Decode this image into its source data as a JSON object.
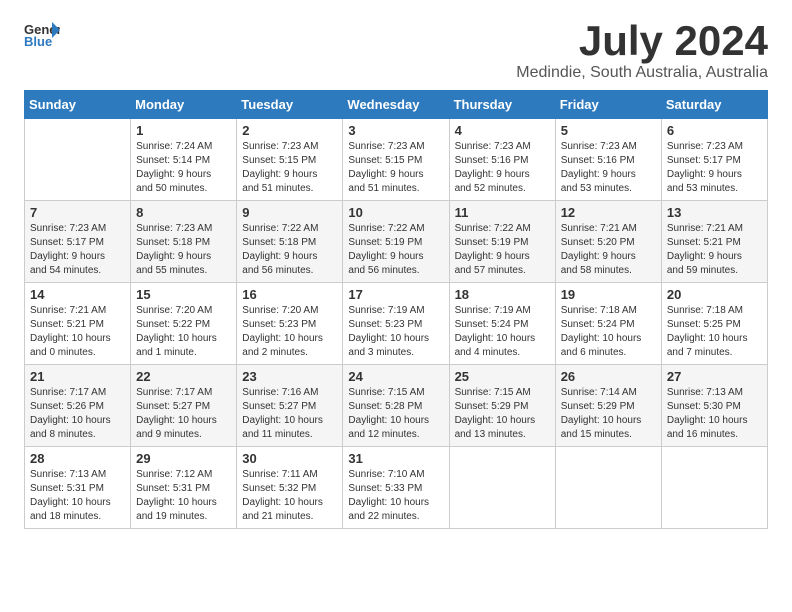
{
  "header": {
    "logo_line1": "General",
    "logo_line2": "Blue",
    "title": "July 2024",
    "subtitle": "Medindie, South Australia, Australia"
  },
  "weekdays": [
    "Sunday",
    "Monday",
    "Tuesday",
    "Wednesday",
    "Thursday",
    "Friday",
    "Saturday"
  ],
  "weeks": [
    [
      {
        "day": "",
        "info": ""
      },
      {
        "day": "1",
        "info": "Sunrise: 7:24 AM\nSunset: 5:14 PM\nDaylight: 9 hours\nand 50 minutes."
      },
      {
        "day": "2",
        "info": "Sunrise: 7:23 AM\nSunset: 5:15 PM\nDaylight: 9 hours\nand 51 minutes."
      },
      {
        "day": "3",
        "info": "Sunrise: 7:23 AM\nSunset: 5:15 PM\nDaylight: 9 hours\nand 51 minutes."
      },
      {
        "day": "4",
        "info": "Sunrise: 7:23 AM\nSunset: 5:16 PM\nDaylight: 9 hours\nand 52 minutes."
      },
      {
        "day": "5",
        "info": "Sunrise: 7:23 AM\nSunset: 5:16 PM\nDaylight: 9 hours\nand 53 minutes."
      },
      {
        "day": "6",
        "info": "Sunrise: 7:23 AM\nSunset: 5:17 PM\nDaylight: 9 hours\nand 53 minutes."
      }
    ],
    [
      {
        "day": "7",
        "info": "Sunrise: 7:23 AM\nSunset: 5:17 PM\nDaylight: 9 hours\nand 54 minutes."
      },
      {
        "day": "8",
        "info": "Sunrise: 7:23 AM\nSunset: 5:18 PM\nDaylight: 9 hours\nand 55 minutes."
      },
      {
        "day": "9",
        "info": "Sunrise: 7:22 AM\nSunset: 5:18 PM\nDaylight: 9 hours\nand 56 minutes."
      },
      {
        "day": "10",
        "info": "Sunrise: 7:22 AM\nSunset: 5:19 PM\nDaylight: 9 hours\nand 56 minutes."
      },
      {
        "day": "11",
        "info": "Sunrise: 7:22 AM\nSunset: 5:19 PM\nDaylight: 9 hours\nand 57 minutes."
      },
      {
        "day": "12",
        "info": "Sunrise: 7:21 AM\nSunset: 5:20 PM\nDaylight: 9 hours\nand 58 minutes."
      },
      {
        "day": "13",
        "info": "Sunrise: 7:21 AM\nSunset: 5:21 PM\nDaylight: 9 hours\nand 59 minutes."
      }
    ],
    [
      {
        "day": "14",
        "info": "Sunrise: 7:21 AM\nSunset: 5:21 PM\nDaylight: 10 hours\nand 0 minutes."
      },
      {
        "day": "15",
        "info": "Sunrise: 7:20 AM\nSunset: 5:22 PM\nDaylight: 10 hours\nand 1 minute."
      },
      {
        "day": "16",
        "info": "Sunrise: 7:20 AM\nSunset: 5:23 PM\nDaylight: 10 hours\nand 2 minutes."
      },
      {
        "day": "17",
        "info": "Sunrise: 7:19 AM\nSunset: 5:23 PM\nDaylight: 10 hours\nand 3 minutes."
      },
      {
        "day": "18",
        "info": "Sunrise: 7:19 AM\nSunset: 5:24 PM\nDaylight: 10 hours\nand 4 minutes."
      },
      {
        "day": "19",
        "info": "Sunrise: 7:18 AM\nSunset: 5:24 PM\nDaylight: 10 hours\nand 6 minutes."
      },
      {
        "day": "20",
        "info": "Sunrise: 7:18 AM\nSunset: 5:25 PM\nDaylight: 10 hours\nand 7 minutes."
      }
    ],
    [
      {
        "day": "21",
        "info": "Sunrise: 7:17 AM\nSunset: 5:26 PM\nDaylight: 10 hours\nand 8 minutes."
      },
      {
        "day": "22",
        "info": "Sunrise: 7:17 AM\nSunset: 5:27 PM\nDaylight: 10 hours\nand 9 minutes."
      },
      {
        "day": "23",
        "info": "Sunrise: 7:16 AM\nSunset: 5:27 PM\nDaylight: 10 hours\nand 11 minutes."
      },
      {
        "day": "24",
        "info": "Sunrise: 7:15 AM\nSunset: 5:28 PM\nDaylight: 10 hours\nand 12 minutes."
      },
      {
        "day": "25",
        "info": "Sunrise: 7:15 AM\nSunset: 5:29 PM\nDaylight: 10 hours\nand 13 minutes."
      },
      {
        "day": "26",
        "info": "Sunrise: 7:14 AM\nSunset: 5:29 PM\nDaylight: 10 hours\nand 15 minutes."
      },
      {
        "day": "27",
        "info": "Sunrise: 7:13 AM\nSunset: 5:30 PM\nDaylight: 10 hours\nand 16 minutes."
      }
    ],
    [
      {
        "day": "28",
        "info": "Sunrise: 7:13 AM\nSunset: 5:31 PM\nDaylight: 10 hours\nand 18 minutes."
      },
      {
        "day": "29",
        "info": "Sunrise: 7:12 AM\nSunset: 5:31 PM\nDaylight: 10 hours\nand 19 minutes."
      },
      {
        "day": "30",
        "info": "Sunrise: 7:11 AM\nSunset: 5:32 PM\nDaylight: 10 hours\nand 21 minutes."
      },
      {
        "day": "31",
        "info": "Sunrise: 7:10 AM\nSunset: 5:33 PM\nDaylight: 10 hours\nand 22 minutes."
      },
      {
        "day": "",
        "info": ""
      },
      {
        "day": "",
        "info": ""
      },
      {
        "day": "",
        "info": ""
      }
    ]
  ]
}
